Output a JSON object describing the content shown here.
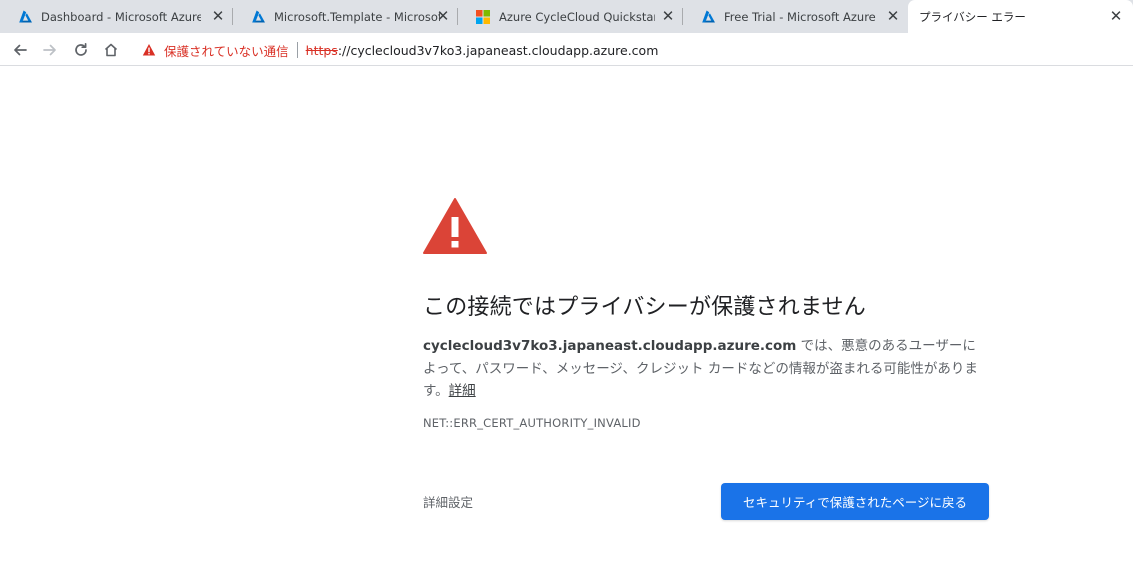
{
  "tabs": [
    {
      "title": "Dashboard - Microsoft Azure",
      "icon": "azure-logo-icon"
    },
    {
      "title": "Microsoft.Template - Microsoft Azure",
      "icon": "azure-logo-icon"
    },
    {
      "title": "Azure CycleCloud Quickstart - Inst",
      "icon": "microsoft-logo-icon"
    },
    {
      "title": "Free Trial - Microsoft Azure",
      "icon": "azure-logo-icon"
    },
    {
      "title": "プライバシー エラー",
      "icon": ""
    }
  ],
  "toolbar": {
    "security_label": "保護されていない通信",
    "url_scheme": "https",
    "url_rest": "://cyclecloud3v7ko3.japaneast.cloudapp.azure.com"
  },
  "interstitial": {
    "heading": "この接続ではプライバシーが保護されません",
    "host": "cyclecloud3v7ko3.japaneast.cloudapp.azure.com",
    "explanation": " では、悪意のあるユーザーによって、パスワード、メッセージ、クレジット カードなどの情報が盗まれる可能性があります。",
    "details_link": "詳細",
    "error_code": "NET::ERR_CERT_AUTHORITY_INVALID",
    "advanced_label": "詳細設定",
    "back_button_label": "セキュリティで保護されたページに戻る"
  },
  "colors": {
    "warning_red": "#d93025",
    "primary_blue": "#1a73e8",
    "azure_blue": "#0078d4"
  }
}
